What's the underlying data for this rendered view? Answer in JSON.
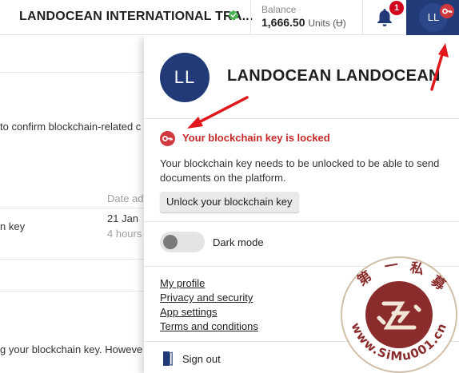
{
  "topbar": {
    "company_name": "LANDOCEAN INTERNATIONAL TRA...",
    "balance_label": "Balance",
    "balance_amount": "1,666.50",
    "balance_units": "Units (Ʉ)",
    "notification_count": "1",
    "user_initials": "LL"
  },
  "background_page": {
    "line1": "to confirm blockchain-related c",
    "col_date_header": "Date ad",
    "row_label": "n key",
    "row_date": "21 Jan",
    "row_age": "4 hours",
    "line_bottom": "g your blockchain key. Howeve"
  },
  "panel": {
    "avatar_initials": "LL",
    "user_name": "LANDOCEAN LANDOCEAN",
    "lock_title": "Your blockchain key is locked",
    "lock_description": "Your blockchain key needs to be unlocked to be able to send documents on the platform.",
    "unlock_button": "Unlock your blockchain key",
    "dark_mode_label": "Dark mode",
    "dark_mode_on": false,
    "links": [
      "My profile",
      "Privacy and security",
      "App settings",
      "Terms and conditions"
    ],
    "sign_out": "Sign out"
  },
  "watermark": {
    "chars": [
      "第",
      "一",
      "私",
      "募"
    ],
    "url": "www.SiMu001.cn"
  },
  "colors": {
    "navy": "#223a77",
    "alert_red": "#c62828",
    "key_red": "#d0393e",
    "verified_green": "#4caf50",
    "seal_red": "#8b2c2c"
  },
  "icons": {
    "verified": "check-badge-icon",
    "bell": "bell-icon",
    "key": "key-icon",
    "sign_out": "door-exit-icon"
  }
}
